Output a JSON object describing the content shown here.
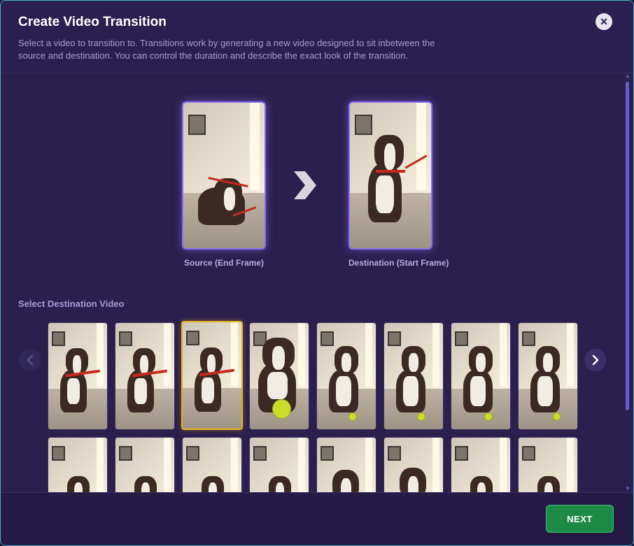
{
  "dialog": {
    "title": "Create Video Transition",
    "description": "Select a video to transition to. Transitions work by generating a new video designed to sit inbetween the source and destination. You can control the duration and describe the exact look of the transition.",
    "close_icon": "close-icon"
  },
  "preview": {
    "source_label": "Source (End Frame)",
    "destination_label": "Destination (Start Frame)",
    "arrow_icon": "chevron-right-icon"
  },
  "gallery": {
    "section_label": "Select Destination Video",
    "selected_index": 2,
    "prev_icon": "chevron-left-icon",
    "next_icon": "chevron-right-icon"
  },
  "footer": {
    "next_label": "NEXT"
  },
  "colors": {
    "background": "#2a1f4d",
    "accent": "#8b6cf5",
    "selected_border": "#e9b21a",
    "next_button": "#1d8a45"
  }
}
